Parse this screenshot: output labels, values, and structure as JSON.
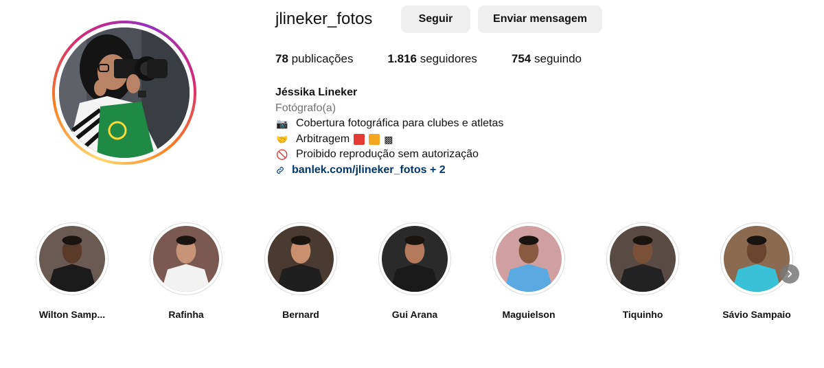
{
  "profile": {
    "username": "jlineker_fotos",
    "follow_label": "Seguir",
    "message_label": "Enviar mensagem",
    "stats": {
      "posts_count": "78",
      "posts_label": "publicações",
      "followers_count": "1.816",
      "followers_label": "seguidores",
      "following_count": "754",
      "following_label": "seguindo"
    },
    "bio": {
      "name": "Jéssika Lineker",
      "category": "Fotógrafo(a)",
      "line1_emoji": "📷",
      "line1": "Cobertura fotográfica para clubes e atletas",
      "line2_emoji": "🤝",
      "line2": "Arbitragem",
      "line3_emoji": "🚫",
      "line3": "Proibido reprodução sem autorização",
      "link_text": "banlek.com/jlineker_fotos + 2"
    }
  },
  "highlights": [
    {
      "label": "Wilton Samp...",
      "jersey": "#1b1b1b",
      "bg": "#6b5a52",
      "skin": "#5a3a28"
    },
    {
      "label": "Rafinha",
      "jersey": "#f2f2f2",
      "bg": "#7a5a50",
      "skin": "#c89478"
    },
    {
      "label": "Bernard",
      "jersey": "#1f1f1f",
      "bg": "#4a3a30",
      "skin": "#c9906f"
    },
    {
      "label": "Gui Arana",
      "jersey": "#1a1a1a",
      "bg": "#2a2a2a",
      "skin": "#b27a5a"
    },
    {
      "label": "Maguielson",
      "jersey": "#5aa9e0",
      "bg": "#d0a0a0",
      "skin": "#8a5a40"
    },
    {
      "label": "Tiquinho",
      "jersey": "#222222",
      "bg": "#5a4a44",
      "skin": "#7a5038"
    },
    {
      "label": "Sávio Sampaio",
      "jersey": "#39c1d8",
      "bg": "#8a6a50",
      "skin": "#6b4530"
    }
  ],
  "colors": {
    "button_bg": "#efefef",
    "link": "#00376b",
    "muted": "#737373"
  },
  "icons": {
    "next": "chevron-right-icon",
    "link": "link-icon"
  }
}
